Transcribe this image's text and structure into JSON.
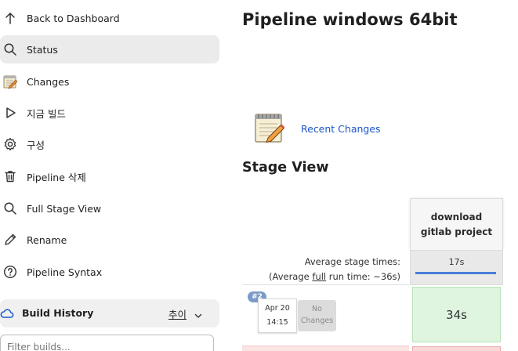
{
  "sidebar": {
    "items": [
      {
        "label": "Back to Dashboard",
        "icon": "arrow-up-icon"
      },
      {
        "label": "Status",
        "icon": "search-icon"
      },
      {
        "label": "Changes",
        "icon": "notepad-icon"
      },
      {
        "label": "지금 빌드",
        "icon": "play-icon"
      },
      {
        "label": "구성",
        "icon": "gear-icon"
      },
      {
        "label": "Pipeline 삭제",
        "icon": "trash-icon"
      },
      {
        "label": "Full Stage View",
        "icon": "search-icon"
      },
      {
        "label": "Rename",
        "icon": "pencil-icon"
      },
      {
        "label": "Pipeline Syntax",
        "icon": "help-icon"
      }
    ],
    "active_index": 1
  },
  "build_history": {
    "title": "Build History",
    "trend_label": "추이",
    "filter_placeholder": "Filter builds..."
  },
  "main": {
    "title": "Pipeline windows 64bit",
    "recent_changes": "Recent Changes",
    "stage_view_heading": "Stage View",
    "avg_stage_label": "Average stage times:",
    "avg_full_prefix": "(Average ",
    "avg_full_word": "full",
    "avg_full_suffix": " run time: ~36s)"
  },
  "stage": {
    "name": "download gitlab project",
    "avg_time": "17s",
    "avg_progress": 1.0
  },
  "builds": [
    {
      "number": "#2",
      "date": "Apr 20",
      "time": "14:15",
      "changes": "No Changes",
      "stage_time": "34s",
      "status": "success"
    }
  ],
  "colors": {
    "active_bg": "#ebebeb",
    "link": "#1a56c9",
    "success_cell": "#dff5df",
    "failed_cell": "#f8d8d8",
    "badge": "#7b9bc8",
    "progress": "#4a7fd6"
  }
}
